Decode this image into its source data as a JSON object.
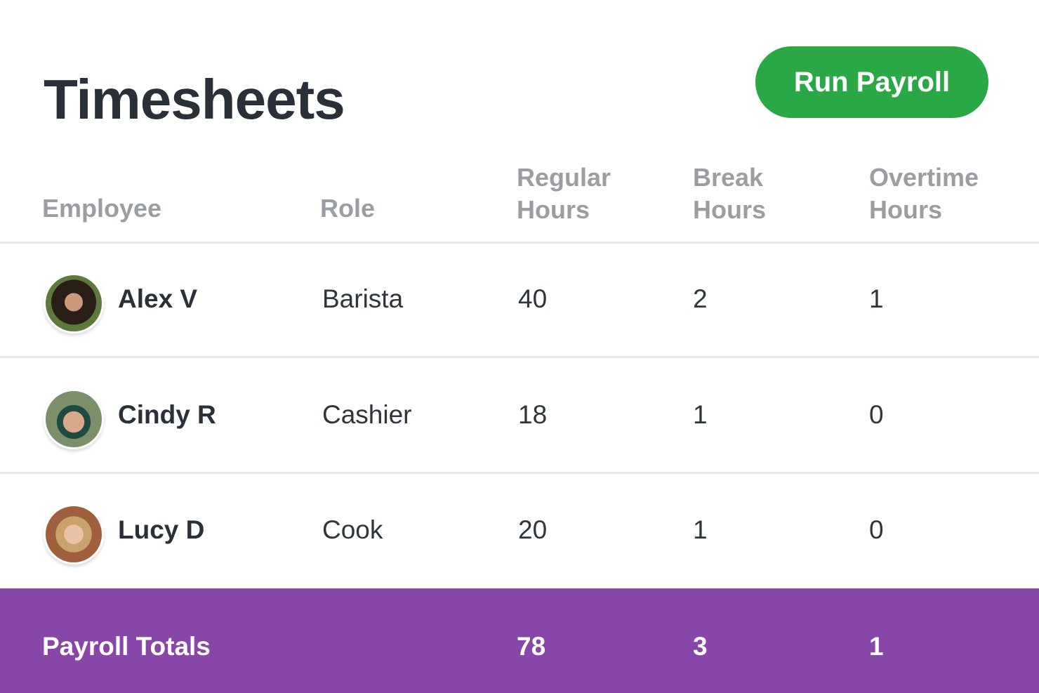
{
  "page": {
    "title": "Timesheets",
    "run_payroll_label": "Run Payroll"
  },
  "colors": {
    "accent_green": "#2aa846",
    "totals_purple": "#8746a8"
  },
  "table": {
    "headers": {
      "employee": "Employee",
      "role": "Role",
      "regular_1": "Regular",
      "regular_2": "Hours",
      "break_1": "Break",
      "break_2": "Hours",
      "overtime_1": "Overtime",
      "overtime_2": "Hours"
    },
    "rows": [
      {
        "name": "Alex V",
        "role": "Barista",
        "regular": "40",
        "break": "2",
        "overtime": "1",
        "avatar": "avatar-photo"
      },
      {
        "name": "Cindy R",
        "role": "Cashier",
        "regular": "18",
        "break": "1",
        "overtime": "0",
        "avatar": "avatar-photo"
      },
      {
        "name": "Lucy D",
        "role": "Cook",
        "regular": "20",
        "break": "1",
        "overtime": "0",
        "avatar": "avatar-photo"
      }
    ],
    "totals": {
      "label": "Payroll Totals",
      "regular": "78",
      "break": "3",
      "overtime": "1"
    }
  }
}
